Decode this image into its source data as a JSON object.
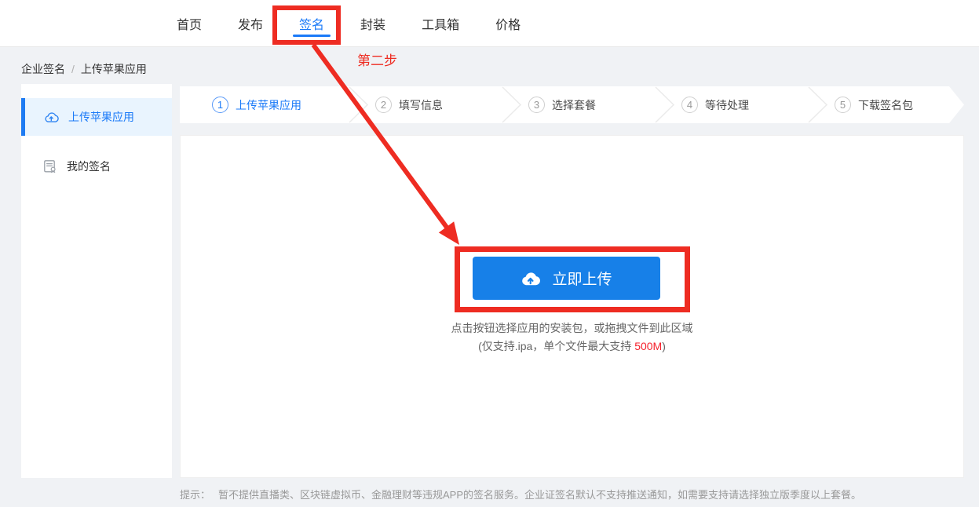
{
  "nav": {
    "items": [
      {
        "label": "首页"
      },
      {
        "label": "发布"
      },
      {
        "label": "签名"
      },
      {
        "label": "封装"
      },
      {
        "label": "工具箱"
      },
      {
        "label": "价格"
      }
    ]
  },
  "annotation": {
    "step_text": "第二步"
  },
  "breadcrumb": {
    "section": "企业签名",
    "separator": "/",
    "current": "上传苹果应用"
  },
  "sidebar": {
    "items": [
      {
        "label": "上传苹果应用",
        "icon": "cloud-upload-icon"
      },
      {
        "label": "我的签名",
        "icon": "signature-doc-icon"
      }
    ]
  },
  "wizard": {
    "steps": [
      {
        "number": "1",
        "label": "上传苹果应用"
      },
      {
        "number": "2",
        "label": "填写信息"
      },
      {
        "number": "3",
        "label": "选择套餐"
      },
      {
        "number": "4",
        "label": "等待处理"
      },
      {
        "number": "5",
        "label": "下载签名包"
      }
    ]
  },
  "upload": {
    "button_label": "立即上传",
    "hint_line1": "点击按钮选择应用的安装包，或拖拽文件到此区域",
    "hint_line2_prefix": "(仅支持.ipa，单个文件最大支持 ",
    "hint_line2_highlight": "500M",
    "hint_line2_suffix": ")"
  },
  "footer": {
    "tip_label": "提示：",
    "tip_text": "暂不提供直播类、区块链虚拟币、金融理财等违规APP的签名服务。企业证签名默认不支持推送通知，如需要支持请选择独立版季度以上套餐。"
  },
  "colors": {
    "accent_blue": "#1a7af8",
    "button_blue": "#1780e8",
    "annotation_red": "#ee2c22",
    "highlight_red": "#f5222d",
    "page_bg": "#f0f2f5"
  }
}
